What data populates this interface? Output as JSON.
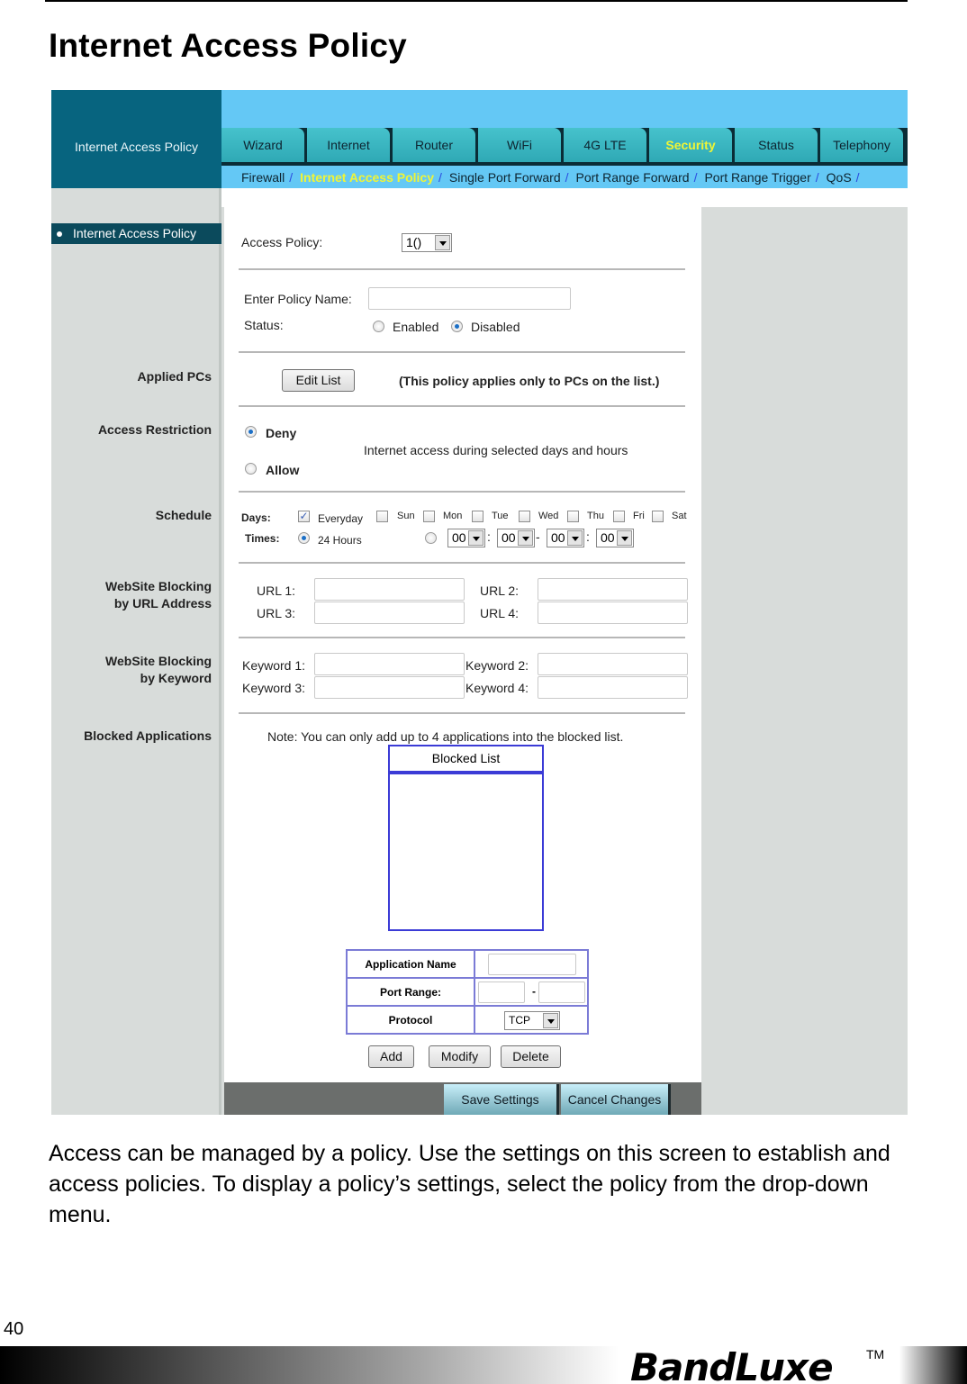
{
  "document": {
    "title": "Internet Access Policy",
    "paragraph": "Access can be managed by a policy. Use the settings on this screen to establish and access policies. To display a policy’s settings, select the policy from the drop-down menu.",
    "page_number": "40",
    "brand": "BandLuxe",
    "trademark": "TM"
  },
  "router_ui": {
    "header_title": "Internet Access Policy",
    "tabs": [
      {
        "label": "Wizard",
        "active": false
      },
      {
        "label": "Internet",
        "active": false
      },
      {
        "label": "Router",
        "active": false
      },
      {
        "label": "WiFi",
        "active": false
      },
      {
        "label": "4G LTE",
        "active": false
      },
      {
        "label": "Security",
        "active": true
      },
      {
        "label": "Status",
        "active": false
      },
      {
        "label": "Telephony",
        "active": false
      }
    ],
    "subnav": [
      {
        "label": "Firewall",
        "active": false
      },
      {
        "label": "Internet Access Policy",
        "active": true
      },
      {
        "label": "Single Port Forward",
        "active": false
      },
      {
        "label": "Port Range Forward",
        "active": false
      },
      {
        "label": "Port Range Trigger",
        "active": false
      },
      {
        "label": "QoS",
        "active": false
      }
    ],
    "subnav_separator": "/",
    "sidebar_active": "Internet Access Policy",
    "section_labels": {
      "applied_pcs": "Applied PCs",
      "access_restriction": "Access Restriction",
      "schedule": "Schedule",
      "url_blocking_1": "WebSite Blocking",
      "url_blocking_2": "by URL Address",
      "kw_blocking_1": "WebSite Blocking",
      "kw_blocking_2": "by Keyword",
      "blocked_apps": "Blocked Applications"
    },
    "access_policy": {
      "label": "Access Policy:",
      "selected": "1()"
    },
    "policy_name": {
      "label": "Enter Policy Name:",
      "value": ""
    },
    "status": {
      "label": "Status:",
      "options": [
        "Enabled",
        "Disabled"
      ],
      "selected": "Disabled"
    },
    "applied_pcs": {
      "button": "Edit List",
      "note": "(This policy applies only to PCs on the list.)"
    },
    "restriction": {
      "options": [
        "Deny",
        "Allow"
      ],
      "selected": "Deny",
      "description": "Internet access during selected days and hours"
    },
    "schedule": {
      "days_label": "Days:",
      "days": [
        {
          "label": "Everyday",
          "checked": true
        },
        {
          "label": "Sun",
          "checked": false
        },
        {
          "label": "Mon",
          "checked": false
        },
        {
          "label": "Tue",
          "checked": false
        },
        {
          "label": "Wed",
          "checked": false
        },
        {
          "label": "Thu",
          "checked": false
        },
        {
          "label": "Fri",
          "checked": false
        },
        {
          "label": "Sat",
          "checked": false
        }
      ],
      "times_label": "Times:",
      "time_mode_24h": "24 Hours",
      "time_mode_selected": "24 Hours",
      "time_from_hour": "00",
      "time_from_min": "00",
      "time_to_hour": "00",
      "time_to_min": "00",
      "colon": ":",
      "dash": "-"
    },
    "urls": [
      {
        "label": "URL 1:",
        "value": ""
      },
      {
        "label": "URL 2:",
        "value": ""
      },
      {
        "label": "URL 3:",
        "value": ""
      },
      {
        "label": "URL 4:",
        "value": ""
      }
    ],
    "keywords": [
      {
        "label": "Keyword 1:",
        "value": ""
      },
      {
        "label": "Keyword 2:",
        "value": ""
      },
      {
        "label": "Keyword 3:",
        "value": ""
      },
      {
        "label": "Keyword 4:",
        "value": ""
      }
    ],
    "blocked_apps": {
      "note": "Note: You can only add up to 4 applications into the blocked list.",
      "list_header": "Blocked List",
      "items": [],
      "app_name_label": "Application Name",
      "app_name_value": "",
      "port_range_label": "Port Range:",
      "port_from": "",
      "port_to": "",
      "port_dash": "-",
      "protocol_label": "Protocol",
      "protocol_selected": "TCP",
      "add_button": "Add",
      "modify_button": "Modify",
      "delete_button": "Delete"
    },
    "footer": {
      "save": "Save Settings",
      "cancel": "Cancel Changes"
    }
  }
}
